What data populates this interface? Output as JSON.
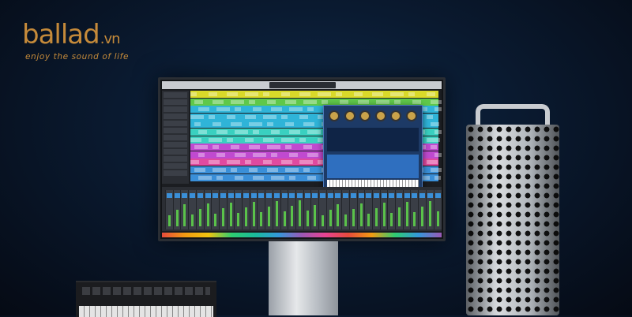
{
  "logo": {
    "brand": "ballad",
    "tld": ".vn",
    "tagline": "enjoy the sound of life"
  },
  "colors": {
    "brand": "#c58a3a",
    "background": "#0a1a30"
  },
  "lanes": [
    {
      "color": "#d9d92a"
    },
    {
      "color": "#5fc84a"
    },
    {
      "color": "#2fb4d8"
    },
    {
      "color": "#2fb4d8"
    },
    {
      "color": "#2fb4d8"
    },
    {
      "color": "#3ad0c0"
    },
    {
      "color": "#3ad0c0"
    },
    {
      "color": "#c04ad0"
    },
    {
      "color": "#c04ad0"
    },
    {
      "color": "#e04aa0"
    },
    {
      "color": "#3a8fd8"
    },
    {
      "color": "#3a8fd8"
    }
  ]
}
